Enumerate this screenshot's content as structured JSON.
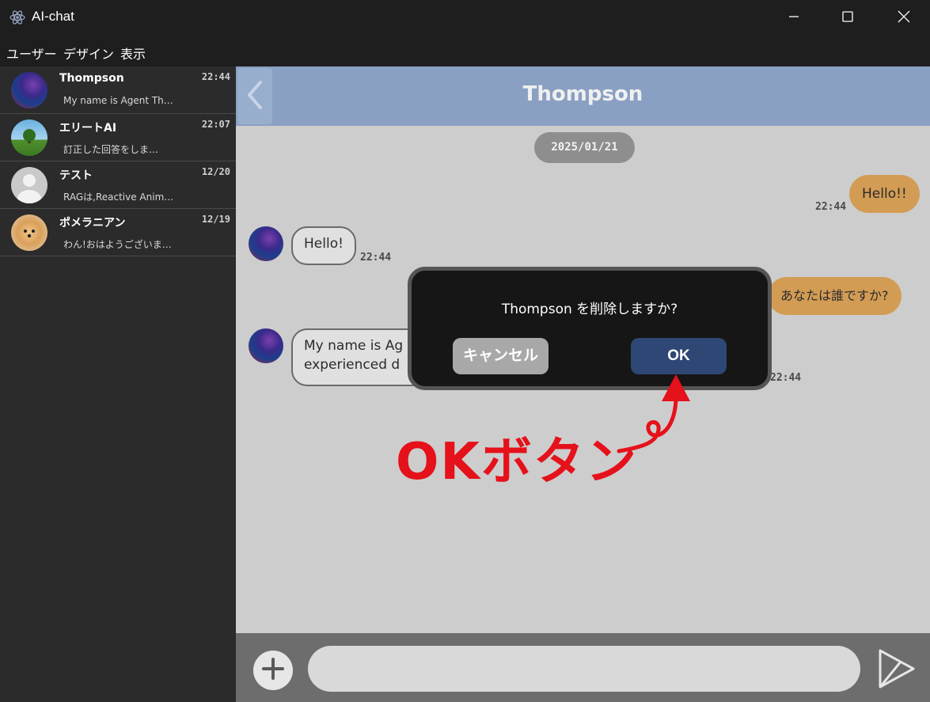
{
  "window": {
    "title": "AI-chat",
    "icons": {
      "app": "atom-icon",
      "minimize": "minimize-icon",
      "maximize": "maximize-icon",
      "close": "close-icon"
    }
  },
  "menu": {
    "items": [
      "ユーザー",
      "デザイン",
      "表示"
    ]
  },
  "sidebar": {
    "chats": [
      {
        "name": "Thompson",
        "time": "22:44",
        "preview": "My name is Agent Th…",
        "avatar": "galaxy-avatar"
      },
      {
        "name": "エリートAI",
        "time": "22:07",
        "preview": "訂正した回答をしま…",
        "avatar": "tree-landscape-avatar"
      },
      {
        "name": "テスト",
        "time": "12/20",
        "preview": "RAGは,Reactive Anim…",
        "avatar": "default-user-avatar"
      },
      {
        "name": "ポメラニアン",
        "time": "12/19",
        "preview": "わん!おはようございま…",
        "avatar": "pomeranian-avatar"
      }
    ]
  },
  "chat": {
    "title": "Thompson",
    "date": "2025/01/21",
    "messages": [
      {
        "direction": "out",
        "text": "Hello!!",
        "time": "22:44"
      },
      {
        "direction": "in",
        "text": "Hello!",
        "time": "22:44"
      },
      {
        "direction": "out",
        "text": "あなたは誰ですか?",
        "time": ""
      },
      {
        "direction": "in",
        "line1": "My name is Ag",
        "line2": "experienced d",
        "time": "22:44"
      }
    ]
  },
  "dialog": {
    "message": "Thompson を削除しますか?",
    "cancel_label": "キャンセル",
    "ok_label": "OK"
  },
  "annotation": {
    "text": "OKボタン",
    "color": "#e5111b"
  },
  "input": {
    "placeholder": "",
    "value": ""
  },
  "colors": {
    "header": "#8aa0c3",
    "outgoing_bubble": "#d39c54",
    "ok_button": "#2e4774",
    "cancel_button": "#a8a8a8"
  }
}
